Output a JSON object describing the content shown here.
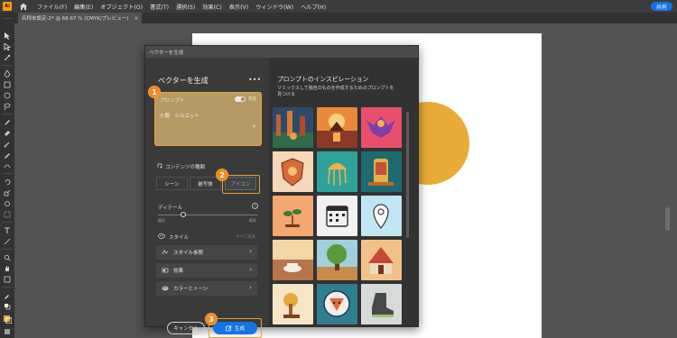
{
  "app": {
    "logo_text": "Ai",
    "menu": [
      "ファイル(F)",
      "編集(E)",
      "オブジェクト(O)",
      "書式(T)",
      "選択(S)",
      "効果(C)",
      "表示(V)",
      "ウィンドウ(W)",
      "ヘルプ(H)"
    ],
    "share_label": "共有"
  },
  "doc_tab": {
    "label": "名称未設定-2* @ 66.67 % (CMYK/プレビュー)",
    "close": "×"
  },
  "dialog": {
    "title": "ベクターを生成",
    "panel_title": "ベクターを生成",
    "more": "•••",
    "prompt": {
      "label": "プロンプト",
      "toggle_label": "英語",
      "text": "小鹿　シルエット",
      "clear": "×"
    },
    "content_type": {
      "label": "コンテンツの種類",
      "options": [
        "シーン",
        "被写体",
        "アイコン"
      ],
      "selected": "アイコン"
    },
    "detail": {
      "label": "ディテール",
      "min_label": "最低",
      "max_label": "最高",
      "value": 0.25
    },
    "style": {
      "label": "スタイル",
      "clear_all": "すべて消去",
      "rows": [
        "スタイル参照",
        "効果",
        "カラーとトーン"
      ]
    },
    "cancel_label": "キャンセル",
    "generate_label": "生成",
    "badges": [
      "1",
      "2",
      "3"
    ],
    "inspiration": {
      "title": "プロンプトのインスピレーション",
      "subtitle": "リミックスして独自のものを作成するためのプロンプトを見つける"
    }
  },
  "colors": {
    "accent_blue": "#1473e6",
    "highlight_orange": "#e8a43a",
    "circle_fill": "#e8ab35"
  }
}
